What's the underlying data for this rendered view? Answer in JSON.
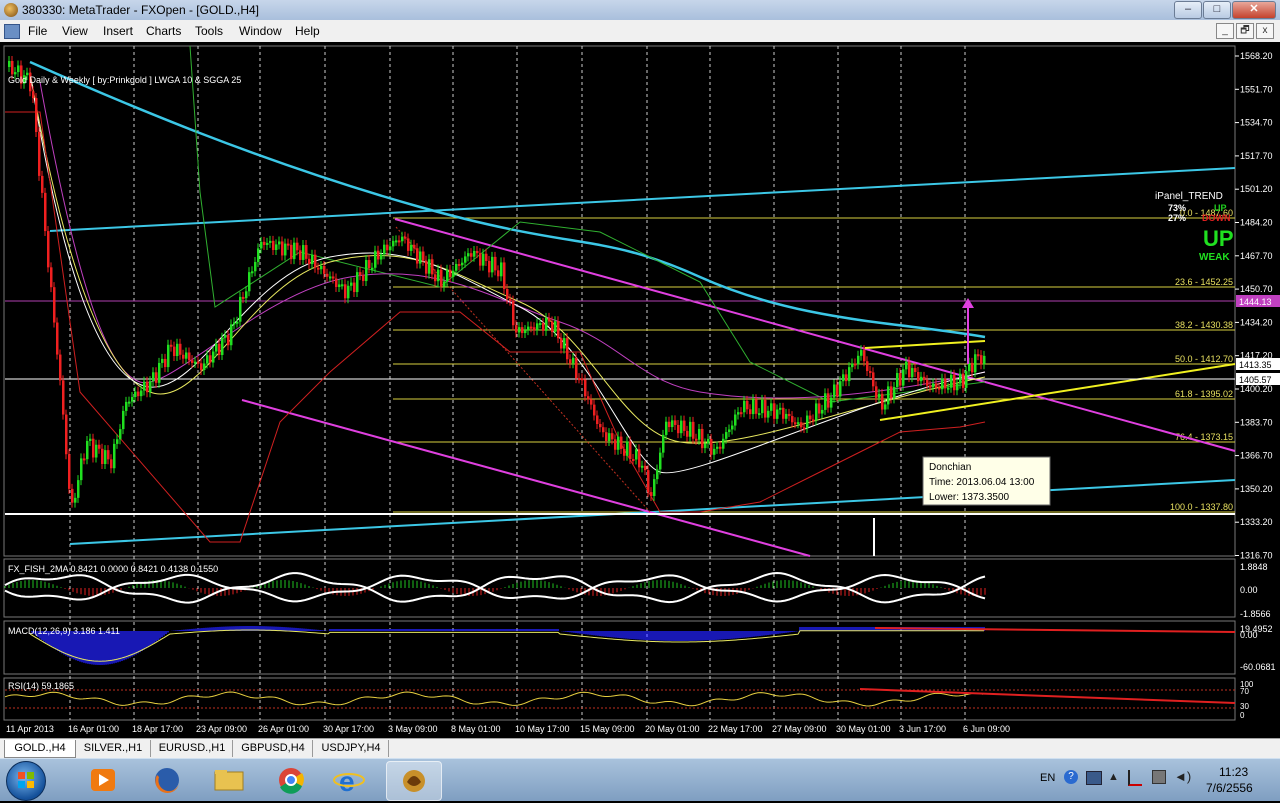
{
  "window": {
    "title": "380330: MetaTrader - FXOpen - [GOLD.,H4]",
    "minimize": "–",
    "maximize": "□",
    "close": "✕"
  },
  "menu": [
    "File",
    "View",
    "Insert",
    "Charts",
    "Tools",
    "Window",
    "Help"
  ],
  "mdi_buttons": [
    "_",
    "🗗",
    "x"
  ],
  "chart": {
    "label": "Gold Daily & Weekly [ by:Prinkgold ]  LWGA 10  &  SGGA 25",
    "price_labels": [
      "1568.20",
      "1551.70",
      "1534.70",
      "1517.70",
      "1501.20",
      "1484.20",
      "1467.70",
      "1450.70",
      "1434.20",
      "1417.20",
      "1400.20",
      "1383.70",
      "1366.70",
      "1350.20",
      "1333.20",
      "1316.70"
    ],
    "current_price_1": "1413.35",
    "current_price_2": "1405.57",
    "magenta_level": "1444.13",
    "fib_labels": [
      "0.0 - 1487.60",
      "23.6 - 1452.25",
      "38.2 - 1430.38",
      "50.0 - 1412.70",
      "61.8 - 1395.02",
      "76.4 - 1373.15",
      "100.0 - 1337.80"
    ],
    "ipanel": {
      "title": "iPanel_TREND",
      "up_pct": "73%",
      "up_word": "UP",
      "down_pct": "27%",
      "down_word": "DOWN",
      "signal": "UP",
      "strength": "WEAK"
    },
    "tooltip": {
      "name": "Donchian",
      "time": "Time: 2013.06.04 13:00",
      "lower": "Lower: 1373.3500"
    },
    "fish": {
      "label": "FX_FISH_2MA 0.8421 0.0000 0.8421 0.4138 0.1550",
      "scale": [
        "1.8848",
        "0.00",
        "-1.8566"
      ]
    },
    "macd": {
      "label": "MACD(12,26,9) 3.186 1.411",
      "scale": [
        "19.4952",
        "0.00",
        "-60.0681"
      ]
    },
    "rsi": {
      "label": "RSI(14) 59.1865",
      "scale": [
        "100",
        "70",
        "30",
        "0"
      ]
    },
    "dates": [
      "11 Apr 2013",
      "16 Apr 01:00",
      "18 Apr 17:00",
      "23 Apr 09:00",
      "26 Apr 01:00",
      "30 Apr 17:00",
      "3 May 09:00",
      "8 May 01:00",
      "10 May 17:00",
      "15 May 09:00",
      "20 May 01:00",
      "22 May 17:00",
      "27 May 09:00",
      "30 May 01:00",
      "3 Jun 17:00",
      "6 Jun 09:00"
    ]
  },
  "tabs": [
    "GOLD.,H4",
    "SILVER.,H1",
    "EURUSD.,H1",
    "GBPUSD,H4",
    "USDJPY,H4"
  ],
  "taskbar": {
    "apps": [
      "media-player",
      "firefox",
      "file-explorer",
      "chrome",
      "internet-explorer",
      "metatrader"
    ],
    "lang": "EN",
    "time": "11:23",
    "date": "7/6/2556"
  }
}
